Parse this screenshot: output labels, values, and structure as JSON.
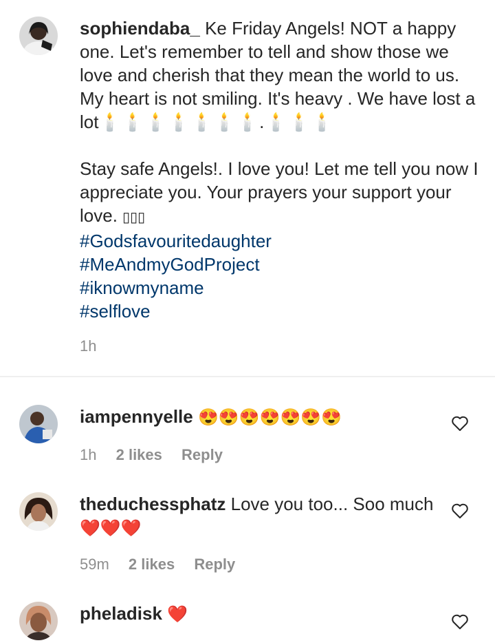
{
  "caption": {
    "username": "sophiendaba_",
    "text_1": "Ke Friday Angels! NOT a happy one. Let's remember to tell and show those we love and cherish that they mean the world to us. My heart is not smiling. It's heavy . We have lost a lot",
    "candles": "🕯️🕯️🕯️🕯️🕯️🕯️🕯️.🕯️🕯️🕯️",
    "text_2": "Stay safe Angels!. I love you! Let me tell you now I appreciate you. Your prayers your support your love. ",
    "text_2_emoji": "▯▯▯",
    "hashtags": [
      "#Godsfavouritedaughter",
      "#MeAndmyGodProject",
      "#iknowmyname",
      "#selflove"
    ],
    "time": "1h"
  },
  "comments": [
    {
      "username": "iampennyelle",
      "text": "",
      "emoji": "😍😍😍😍😍😍😍",
      "time": "1h",
      "likes": "2 likes",
      "reply": "Reply"
    },
    {
      "username": "theduchessphatz",
      "text": "Love you too... Soo much",
      "emoji": "❤️❤️❤️",
      "time": "59m",
      "likes": "2 likes",
      "reply": "Reply"
    },
    {
      "username": "pheladisk",
      "text": "",
      "emoji": "❤️",
      "time": "",
      "likes": "",
      "reply": ""
    }
  ],
  "icons": {
    "like": "heart-outline-icon"
  },
  "colors": {
    "text": "#262626",
    "hashtag": "#00376b",
    "meta": "#8e8e8e",
    "divider": "#efefef"
  }
}
